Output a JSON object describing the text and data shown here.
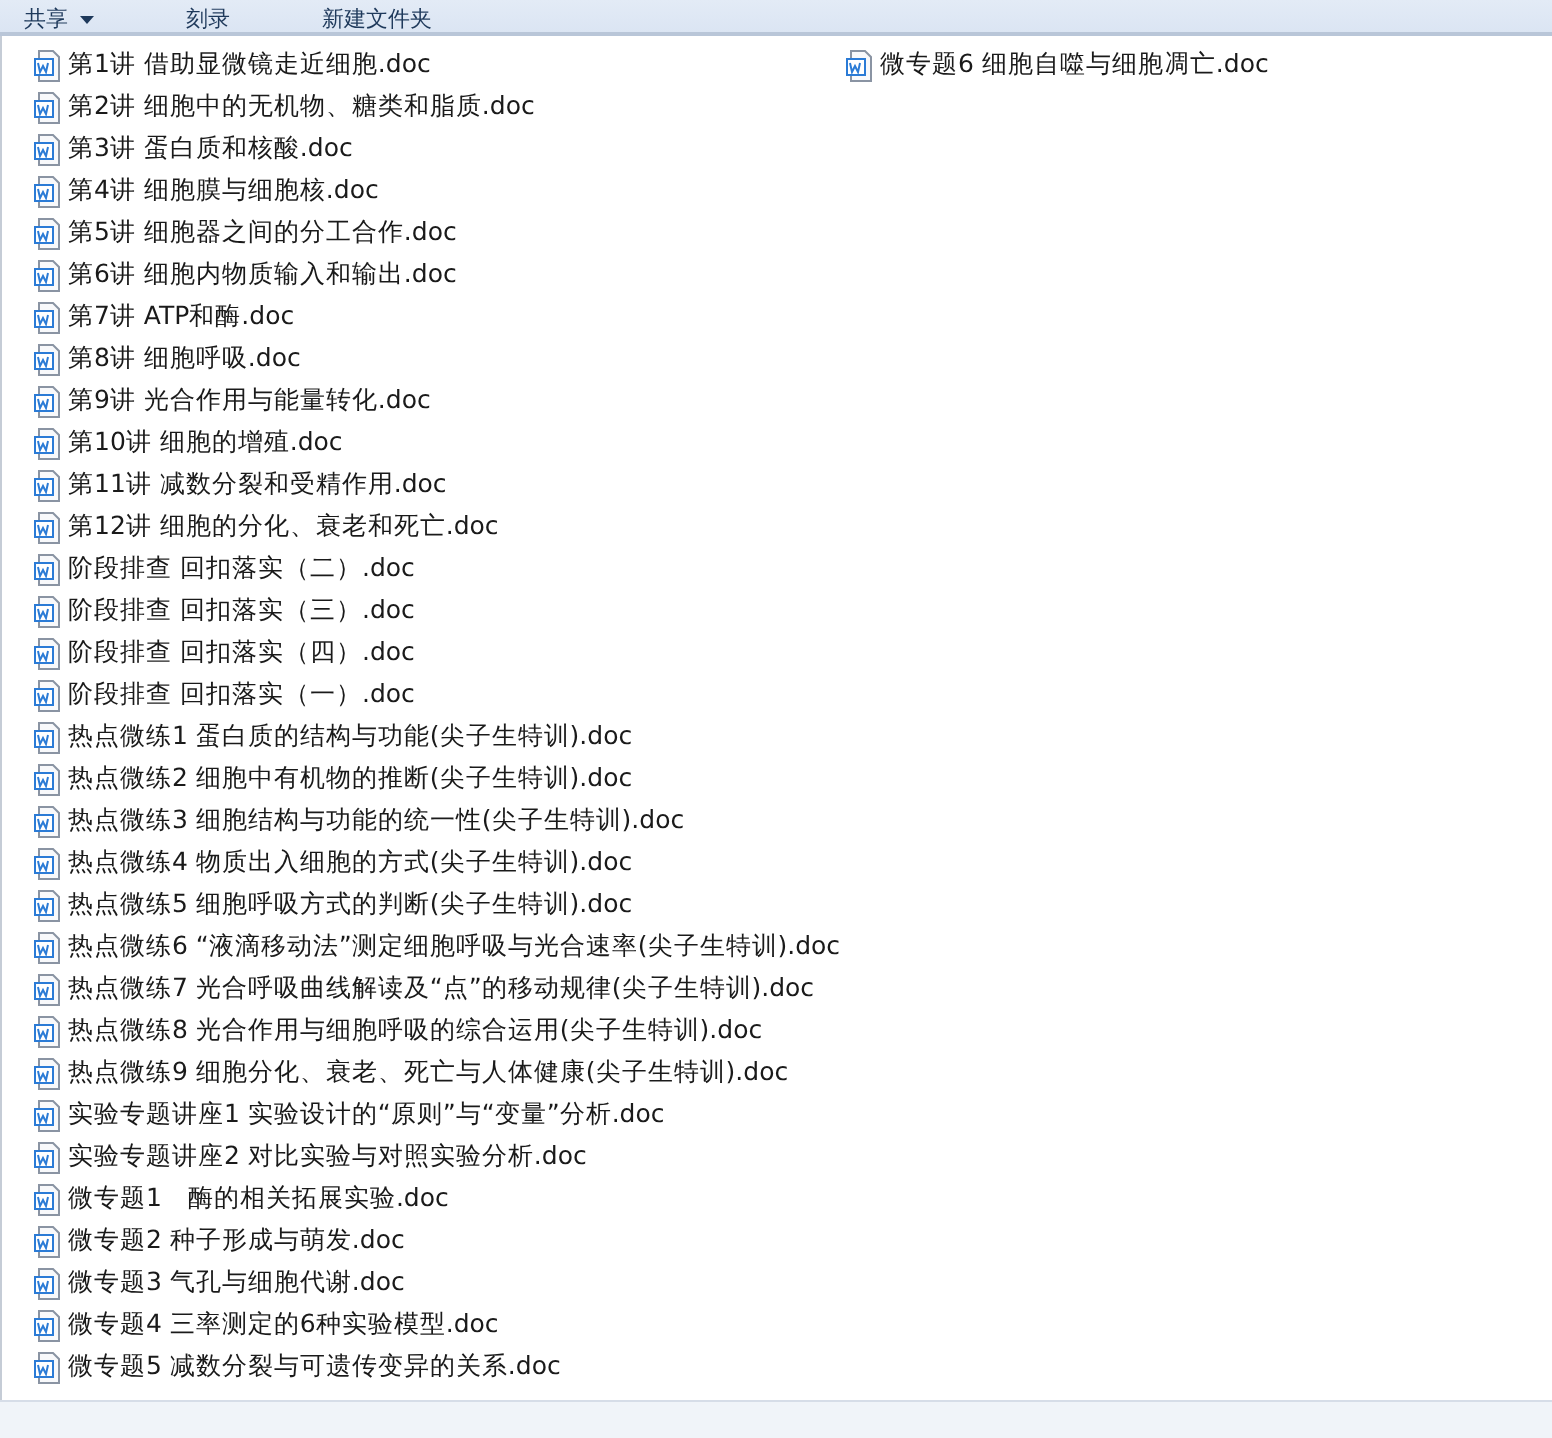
{
  "toolbar": [
    {
      "label": "共享",
      "dropdown": true
    },
    {
      "label": "刻录",
      "dropdown": false
    },
    {
      "label": "新建文件夹",
      "dropdown": false
    }
  ],
  "files": [
    "第1讲 借助显微镜走近细胞.doc",
    "第2讲 细胞中的无机物、糖类和脂质.doc",
    "第3讲 蛋白质和核酸.doc",
    "第4讲 细胞膜与细胞核.doc",
    "第5讲 细胞器之间的分工合作.doc",
    "第6讲 细胞内物质输入和输出.doc",
    "第7讲 ATP和酶.doc",
    "第8讲 细胞呼吸.doc",
    "第9讲 光合作用与能量转化.doc",
    "第10讲 细胞的增殖.doc",
    "第11讲 减数分裂和受精作用.doc",
    "第12讲 细胞的分化、衰老和死亡.doc",
    "阶段排查 回扣落实（二）.doc",
    "阶段排查 回扣落实（三）.doc",
    "阶段排查 回扣落实（四）.doc",
    "阶段排查 回扣落实（一）.doc",
    "热点微练1 蛋白质的结构与功能(尖子生特训).doc",
    "热点微练2 细胞中有机物的推断(尖子生特训).doc",
    "热点微练3 细胞结构与功能的统一性(尖子生特训).doc",
    "热点微练4 物质出入细胞的方式(尖子生特训).doc",
    "热点微练5 细胞呼吸方式的判断(尖子生特训).doc",
    "热点微练6 “液滴移动法”测定细胞呼吸与光合速率(尖子生特训).doc",
    "热点微练7 光合呼吸曲线解读及“点”的移动规律(尖子生特训).doc",
    "热点微练8 光合作用与细胞呼吸的综合运用(尖子生特训).doc",
    "热点微练9 细胞分化、衰老、死亡与人体健康(尖子生特训).doc",
    "实验专题讲座1 实验设计的“原则”与“变量”分析.doc",
    "实验专题讲座2 对比实验与对照实验分析.doc",
    "微专题1　酶的相关拓展实验.doc",
    "微专题2 种子形成与萌发.doc",
    "微专题3 气孔与细胞代谢.doc",
    "微专题4 三率测定的6种实验模型.doc",
    "微专题5 减数分裂与可遗传变异的关系.doc",
    "微专题6 细胞自噬与细胞凋亡.doc"
  ]
}
